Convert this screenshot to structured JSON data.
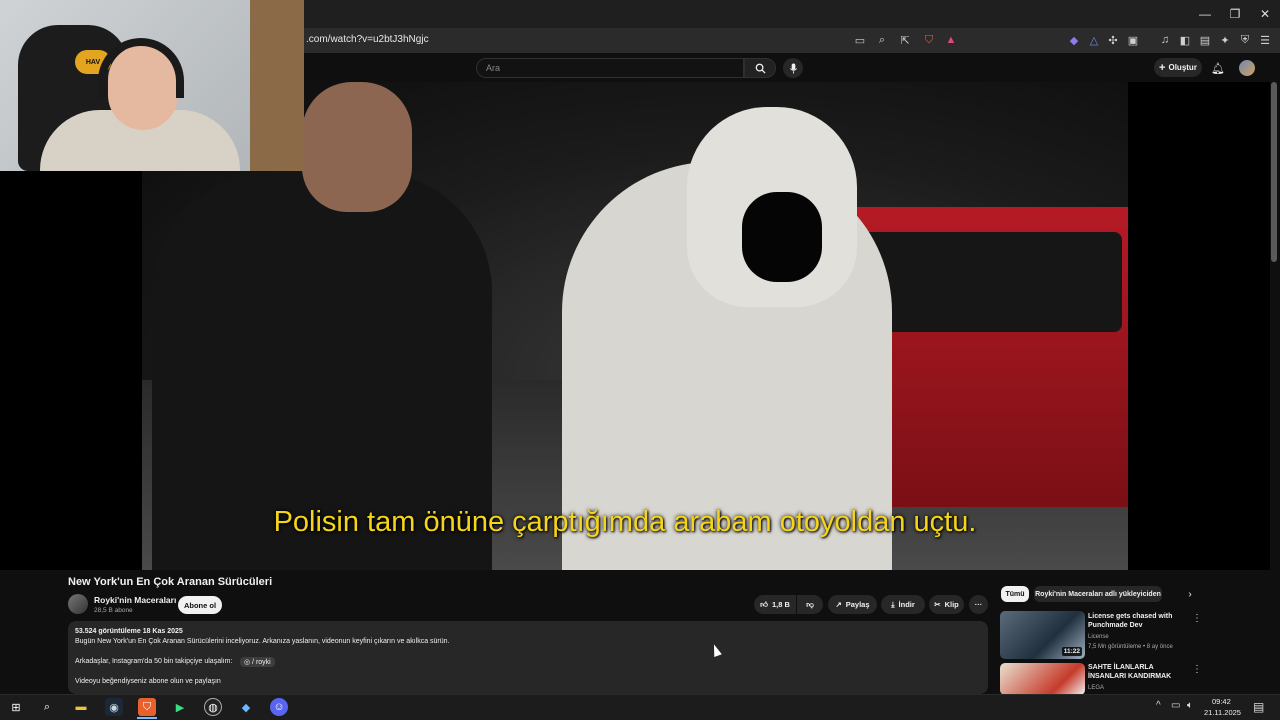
{
  "browser": {
    "url": ".com/watch?v=u2btJ3hNgjc",
    "window_controls": {
      "minimize": "—",
      "restore": "❐",
      "close": "✕"
    },
    "toolbar_icons": [
      "cast-icon",
      "zoom-icon",
      "share-icon",
      "brave-shield-icon",
      "brave-rewards-icon",
      "vpn-icon",
      "leo-icon",
      "extensions-icon",
      "tab-search-icon",
      "media-icon",
      "sidebar-icon",
      "wallet-icon",
      "ai-icon",
      "shield-icon",
      "menu-icon"
    ]
  },
  "youtube": {
    "search_placeholder": "Ara",
    "create_label": "Oluştur"
  },
  "video": {
    "subtitle": "Polisin tam önüne çarptığımda arabam otoyoldan uçtu."
  },
  "webcam": {
    "chair_logo": "HAV"
  },
  "details": {
    "title": "New York'un En Çok Aranan Sürücüleri",
    "channel_name": "Royki'nin Maceraları",
    "channel_subs": "28,5 B abone",
    "subscribe_label": "Abone ol",
    "like_count": "1,8 B",
    "share_label": "Paylaş",
    "download_label": "İndir",
    "clip_label": "Klip",
    "more_label": "···"
  },
  "description": {
    "meta": "53.524 görüntüleme  18 Kas 2025",
    "line1": "Bugün New York'un En Çok Aranan Sürücülerini inceliyoruz. Arkanıza yaslanın, videonun keyfini çıkarın ve akılkca sürün.",
    "line2": "Arkadaşlar, Instagram'da 50 bin takipçiye ulaşalım:",
    "tag": "◎ / royki",
    "line3": "Videoyu beğendiyseniz abone olun ve paylaşın"
  },
  "sidebar": {
    "chips": [
      "Tümü",
      "Royki'nin Maceraları adlı yükleyiciden"
    ],
    "recommendations": [
      {
        "title": "License gets chased with Punchmade Dev",
        "channel": "License",
        "meta": "7,5 Mn görüntüleme • 8 ay önce",
        "duration": "11:22"
      },
      {
        "title": "SAHTE İLANLARLA İNSANLARI KANDIRMAK",
        "channel": "LEGA",
        "meta": "",
        "duration": ""
      }
    ]
  },
  "taskbar": {
    "time": "09:42",
    "date": "21.11.2025",
    "apps": [
      "start-icon",
      "search-icon",
      "file-explorer-icon",
      "steam-icon",
      "brave-icon",
      "terminal-icon",
      "obs-icon",
      "launcher-icon",
      "discord-icon"
    ]
  }
}
